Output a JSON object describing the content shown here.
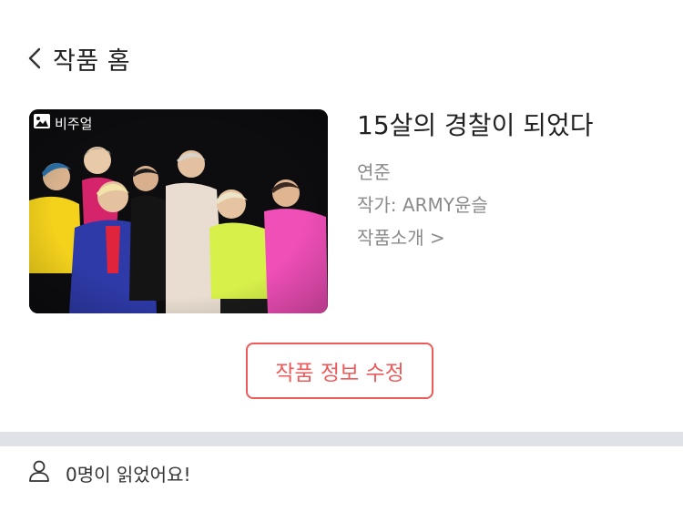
{
  "header": {
    "back_label": "작품 홈"
  },
  "work": {
    "cover_badge": "비주얼",
    "title": "15살의 경찰이 되었다",
    "genre": "연준",
    "author": "작가: ARMY윤슬",
    "intro_link": "작품소개 >"
  },
  "actions": {
    "edit_label": "작품 정보 수정"
  },
  "stats": {
    "readers_text": "0명이 읽었어요!"
  },
  "colors": {
    "accent": "#ec5a5a",
    "divider": "#dfe3e8",
    "meta_text": "#8a8a8a"
  },
  "icons": {
    "back": "chevron-left-icon",
    "badge": "image-icon",
    "readers": "person-icon"
  }
}
